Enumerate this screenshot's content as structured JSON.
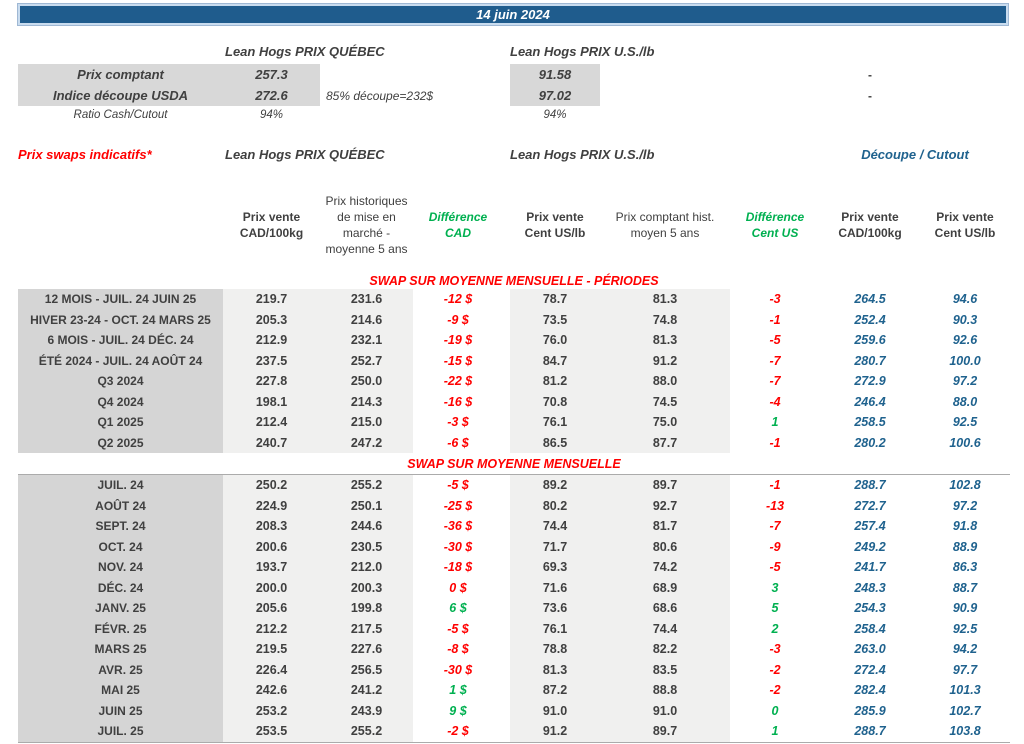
{
  "title_bar": {
    "date": "14 juin 2024"
  },
  "colors": {
    "banner_blue": "#1F5C8D",
    "negative_red": "#FF0000",
    "positive_green": "#00B050",
    "cutout_blue": "#1F628E",
    "label_grey": "#D5D5D5",
    "cell_grey": "#F0F0EF"
  },
  "spot": {
    "quebec_header": "Lean Hogs PRIX QUÉBEC",
    "us_header": "Lean Hogs PRIX U.S./lb",
    "rows": [
      {
        "label": "Prix comptant",
        "quebec": "257.3",
        "us": "91.58",
        "cutout": "-"
      },
      {
        "label": "Indice découpe USDA",
        "quebec": "272.6",
        "note": "85% découpe=232$",
        "us": "97.02",
        "cutout": "-"
      },
      {
        "label": "Ratio Cash/Cutout",
        "quebec": "94%",
        "us": "94%"
      }
    ]
  },
  "swaps": {
    "title": "Prix swaps indicatifs*",
    "quebec_header": "Lean Hogs PRIX QUÉBEC",
    "us_header": "Lean Hogs PRIX U.S./lb",
    "cutout_header": "Découpe / Cutout",
    "column_headers": [
      {
        "lines": "Prix vente\nCAD/100kg",
        "style": "bold"
      },
      {
        "lines": "Prix historiques\nde mise en\nmarché -\nmoyenne 5 ans",
        "style": "regular"
      },
      {
        "lines": "Différence\nCAD",
        "style": "green"
      },
      {
        "lines": "Prix vente\nCent US/lb",
        "style": "bold"
      },
      {
        "lines": "Prix comptant hist.\nmoyen 5 ans",
        "style": "regular"
      },
      {
        "lines": "Différence\nCent US",
        "style": "green"
      },
      {
        "lines": "Prix vente\nCAD/100kg",
        "style": "bold"
      },
      {
        "lines": "Prix vente\nCent US/lb",
        "style": "bold"
      }
    ],
    "sections": [
      {
        "header": "SWAP SUR MOYENNE MENSUELLE - PÉRIODES",
        "rows": [
          {
            "label": "12 MOIS - JUIL. 24 JUIN 25",
            "cad_sell": "219.7",
            "cad_hist": "231.6",
            "diff_cad": "-12 $",
            "diff_cad_color": "red",
            "us_sell": "78.7",
            "us_hist": "81.3",
            "diff_us": "-3",
            "diff_us_color": "red",
            "cutout_cad": "264.5",
            "cutout_us": "94.6"
          },
          {
            "label": "HIVER 23-24 -  OCT. 24 MARS 25",
            "cad_sell": "205.3",
            "cad_hist": "214.6",
            "diff_cad": "-9 $",
            "diff_cad_color": "red",
            "us_sell": "73.5",
            "us_hist": "74.8",
            "diff_us": "-1",
            "diff_us_color": "red",
            "cutout_cad": "252.4",
            "cutout_us": "90.3"
          },
          {
            "label": "6 MOIS -  JUIL. 24 DÉC. 24",
            "cad_sell": "212.9",
            "cad_hist": "232.1",
            "diff_cad": "-19 $",
            "diff_cad_color": "red",
            "us_sell": "76.0",
            "us_hist": "81.3",
            "diff_us": "-5",
            "diff_us_color": "red",
            "cutout_cad": "259.6",
            "cutout_us": "92.6"
          },
          {
            "label": "ÉTÉ 2024 - JUIL. 24 AOÛT 24",
            "cad_sell": "237.5",
            "cad_hist": "252.7",
            "diff_cad": "-15 $",
            "diff_cad_color": "red",
            "us_sell": "84.7",
            "us_hist": "91.2",
            "diff_us": "-7",
            "diff_us_color": "red",
            "cutout_cad": "280.7",
            "cutout_us": "100.0"
          },
          {
            "label": "Q3 2024",
            "cad_sell": "227.8",
            "cad_hist": "250.0",
            "diff_cad": "-22 $",
            "diff_cad_color": "red",
            "us_sell": "81.2",
            "us_hist": "88.0",
            "diff_us": "-7",
            "diff_us_color": "red",
            "cutout_cad": "272.9",
            "cutout_us": "97.2"
          },
          {
            "label": "Q4 2024",
            "cad_sell": "198.1",
            "cad_hist": "214.3",
            "diff_cad": "-16 $",
            "diff_cad_color": "red",
            "us_sell": "70.8",
            "us_hist": "74.5",
            "diff_us": "-4",
            "diff_us_color": "red",
            "cutout_cad": "246.4",
            "cutout_us": "88.0"
          },
          {
            "label": "Q1 2025",
            "cad_sell": "212.4",
            "cad_hist": "215.0",
            "diff_cad": "-3 $",
            "diff_cad_color": "red",
            "us_sell": "76.1",
            "us_hist": "75.0",
            "diff_us": "1",
            "diff_us_color": "green",
            "cutout_cad": "258.5",
            "cutout_us": "92.5"
          },
          {
            "label": "Q2 2025",
            "cad_sell": "240.7",
            "cad_hist": "247.2",
            "diff_cad": "-6 $",
            "diff_cad_color": "red",
            "us_sell": "86.5",
            "us_hist": "87.7",
            "diff_us": "-1",
            "diff_us_color": "red",
            "cutout_cad": "280.2",
            "cutout_us": "100.6"
          }
        ]
      },
      {
        "header": "SWAP SUR MOYENNE MENSUELLE",
        "rows": [
          {
            "label": "JUIL. 24",
            "cad_sell": "250.2",
            "cad_hist": "255.2",
            "diff_cad": "-5 $",
            "diff_cad_color": "red",
            "us_sell": "89.2",
            "us_hist": "89.7",
            "diff_us": "-1",
            "diff_us_color": "red",
            "cutout_cad": "288.7",
            "cutout_us": "102.8"
          },
          {
            "label": "AOÛT 24",
            "cad_sell": "224.9",
            "cad_hist": "250.1",
            "diff_cad": "-25 $",
            "diff_cad_color": "red",
            "us_sell": "80.2",
            "us_hist": "92.7",
            "diff_us": "-13",
            "diff_us_color": "red",
            "cutout_cad": "272.7",
            "cutout_us": "97.2"
          },
          {
            "label": "SEPT. 24",
            "cad_sell": "208.3",
            "cad_hist": "244.6",
            "diff_cad": "-36 $",
            "diff_cad_color": "red",
            "us_sell": "74.4",
            "us_hist": "81.7",
            "diff_us": "-7",
            "diff_us_color": "red",
            "cutout_cad": "257.4",
            "cutout_us": "91.8"
          },
          {
            "label": "OCT. 24",
            "cad_sell": "200.6",
            "cad_hist": "230.5",
            "diff_cad": "-30 $",
            "diff_cad_color": "red",
            "us_sell": "71.7",
            "us_hist": "80.6",
            "diff_us": "-9",
            "diff_us_color": "red",
            "cutout_cad": "249.2",
            "cutout_us": "88.9"
          },
          {
            "label": "NOV. 24",
            "cad_sell": "193.7",
            "cad_hist": "212.0",
            "diff_cad": "-18 $",
            "diff_cad_color": "red",
            "us_sell": "69.3",
            "us_hist": "74.2",
            "diff_us": "-5",
            "diff_us_color": "red",
            "cutout_cad": "241.7",
            "cutout_us": "86.3"
          },
          {
            "label": "DÉC. 24",
            "cad_sell": "200.0",
            "cad_hist": "200.3",
            "diff_cad": "0 $",
            "diff_cad_color": "red",
            "us_sell": "71.6",
            "us_hist": "68.9",
            "diff_us": "3",
            "diff_us_color": "green",
            "cutout_cad": "248.3",
            "cutout_us": "88.7"
          },
          {
            "label": "JANV. 25",
            "cad_sell": "205.6",
            "cad_hist": "199.8",
            "diff_cad": "6 $",
            "diff_cad_color": "green",
            "us_sell": "73.6",
            "us_hist": "68.6",
            "diff_us": "5",
            "diff_us_color": "green",
            "cutout_cad": "254.3",
            "cutout_us": "90.9"
          },
          {
            "label": "FÉVR. 25",
            "cad_sell": "212.2",
            "cad_hist": "217.5",
            "diff_cad": "-5 $",
            "diff_cad_color": "red",
            "us_sell": "76.1",
            "us_hist": "74.4",
            "diff_us": "2",
            "diff_us_color": "green",
            "cutout_cad": "258.4",
            "cutout_us": "92.5"
          },
          {
            "label": "MARS 25",
            "cad_sell": "219.5",
            "cad_hist": "227.6",
            "diff_cad": "-8 $",
            "diff_cad_color": "red",
            "us_sell": "78.8",
            "us_hist": "82.2",
            "diff_us": "-3",
            "diff_us_color": "red",
            "cutout_cad": "263.0",
            "cutout_us": "94.2"
          },
          {
            "label": "AVR. 25",
            "cad_sell": "226.4",
            "cad_hist": "256.5",
            "diff_cad": "-30 $",
            "diff_cad_color": "red",
            "us_sell": "81.3",
            "us_hist": "83.5",
            "diff_us": "-2",
            "diff_us_color": "red",
            "cutout_cad": "272.4",
            "cutout_us": "97.7"
          },
          {
            "label": "MAI 25",
            "cad_sell": "242.6",
            "cad_hist": "241.2",
            "diff_cad": "1 $",
            "diff_cad_color": "green",
            "us_sell": "87.2",
            "us_hist": "88.8",
            "diff_us": "-2",
            "diff_us_color": "red",
            "cutout_cad": "282.4",
            "cutout_us": "101.3"
          },
          {
            "label": "JUIN 25",
            "cad_sell": "253.2",
            "cad_hist": "243.9",
            "diff_cad": "9 $",
            "diff_cad_color": "green",
            "us_sell": "91.0",
            "us_hist": "91.0",
            "diff_us": "0",
            "diff_us_color": "green",
            "cutout_cad": "285.9",
            "cutout_us": "102.7"
          },
          {
            "label": "JUIL. 25",
            "cad_sell": "253.5",
            "cad_hist": "255.2",
            "diff_cad": "-2 $",
            "diff_cad_color": "red",
            "us_sell": "91.2",
            "us_hist": "89.7",
            "diff_us": "1",
            "diff_us_color": "green",
            "cutout_cad": "288.7",
            "cutout_us": "103.8"
          }
        ]
      }
    ]
  }
}
